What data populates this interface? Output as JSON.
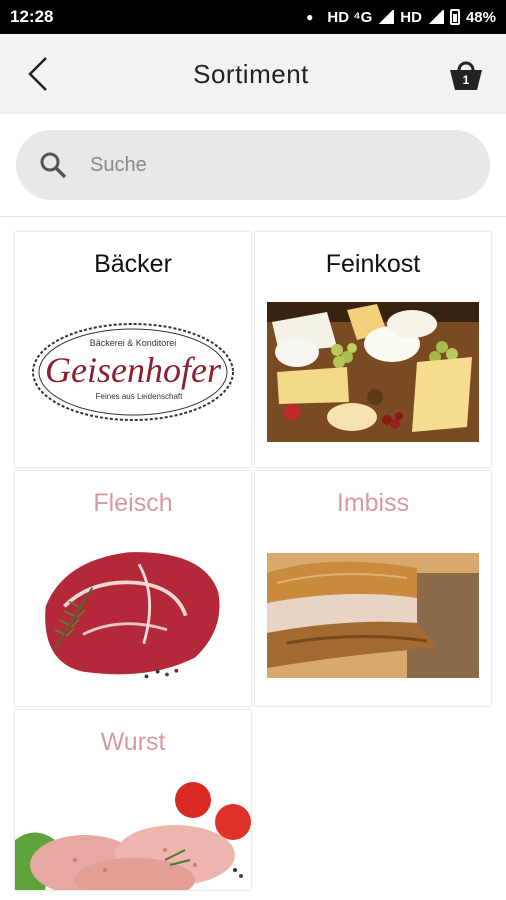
{
  "status": {
    "time": "12:28",
    "network": "HD ⁴G",
    "network2": "HD",
    "battery": "48%"
  },
  "header": {
    "title": "Sortiment",
    "cart_count": "1"
  },
  "search": {
    "placeholder": "Suche"
  },
  "categories": [
    {
      "label": "Bäcker",
      "faded": false,
      "logo_text": "Geisenhofer",
      "logo_sub1": "Bäckerei & Konditorei",
      "logo_sub2": "Feines aus Leidenschaft"
    },
    {
      "label": "Feinkost",
      "faded": false
    },
    {
      "label": "Fleisch",
      "faded": true
    },
    {
      "label": "Imbiss",
      "faded": true
    },
    {
      "label": "Wurst",
      "faded": true
    }
  ],
  "colors": {
    "accent_faded": "#d89aa2",
    "app_bar": "#f2f2f2",
    "logo_red": "#8a1f2e"
  }
}
